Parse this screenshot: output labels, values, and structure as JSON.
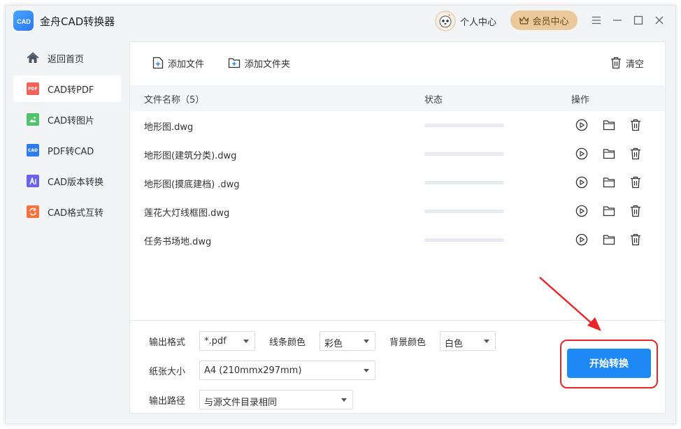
{
  "app": {
    "title": "金舟CAD转换器",
    "logo_text": "CAD"
  },
  "header": {
    "user_center_label": "个人中心",
    "vip_label": "会员中心"
  },
  "sidebar": {
    "items": [
      {
        "label": "返回首页",
        "icon": "home-icon",
        "color": "#4a5566"
      },
      {
        "label": "CAD转PDF",
        "icon": "pdf-file-icon",
        "color": "#f0625a",
        "tag": "PDF"
      },
      {
        "label": "CAD转图片",
        "icon": "image-file-icon",
        "color": "#52c26b"
      },
      {
        "label": "PDF转CAD",
        "icon": "cad-file-icon",
        "color": "#2e7cf0",
        "tag": "CAD"
      },
      {
        "label": "CAD版本转换",
        "icon": "version-file-icon",
        "color": "#6a62e8"
      },
      {
        "label": "CAD格式互转",
        "icon": "convert-file-icon",
        "color": "#f5733e"
      }
    ],
    "active_index": 1
  },
  "toolbar": {
    "add_file_label": "添加文件",
    "add_folder_label": "添加文件夹",
    "clear_label": "清空"
  },
  "table": {
    "headers": {
      "name": "文件名称（5）",
      "status": "状态",
      "actions": "操作"
    },
    "rows": [
      {
        "name": "地形图.dwg",
        "progress": 0
      },
      {
        "name": "地形图(建筑分类).dwg",
        "progress": 0
      },
      {
        "name": "地形图(摸底建档) .dwg",
        "progress": 0
      },
      {
        "name": "莲花大灯线框图.dwg",
        "progress": 0
      },
      {
        "name": "任务书场地.dwg",
        "progress": 0
      }
    ]
  },
  "settings": {
    "output_format_label": "输出格式",
    "output_format_value": "*.pdf",
    "line_color_label": "线条颜色",
    "line_color_value": "彩色",
    "bg_color_label": "背景颜色",
    "bg_color_value": "白色",
    "paper_size_label": "纸张大小",
    "paper_size_value": "A4 (210mmx297mm)",
    "output_path_label": "输出路径",
    "output_path_value": "与源文件目录相同"
  },
  "start_button_label": "开始转换",
  "colors": {
    "accent": "#1e88f5",
    "highlight": "#e8262a",
    "vip": "#ecc99a"
  }
}
